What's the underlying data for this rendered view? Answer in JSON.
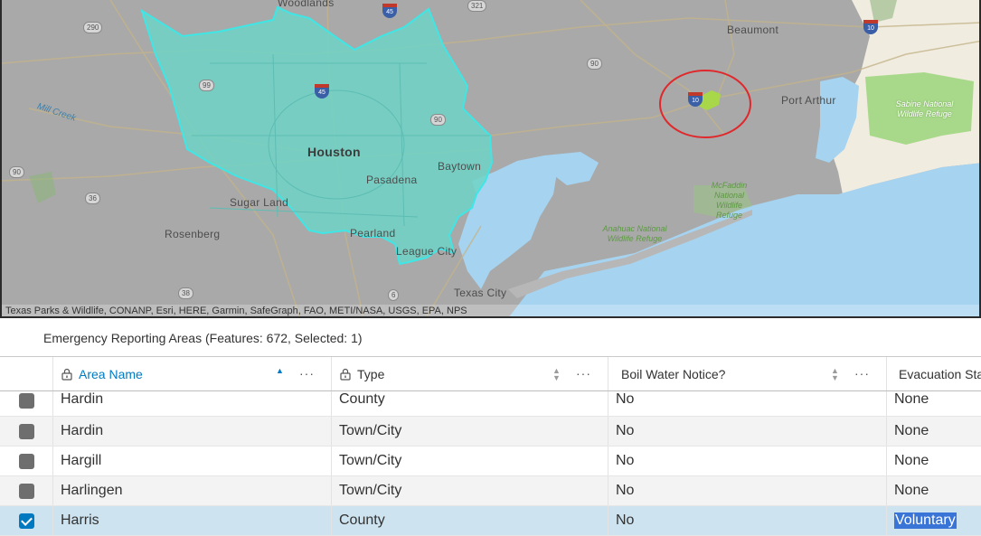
{
  "map": {
    "attribution": "Texas Parks & Wildlife, CONANP, Esri, HERE, Garmin, SafeGraph, FAO, METI/NASA, USGS, EPA, NPS",
    "labels": {
      "woodlands": "Woodlands",
      "beaumont": "Beaumont",
      "port_arthur": "Port Arthur",
      "houston": "Houston",
      "baytown": "Baytown",
      "pasadena": "Pasadena",
      "sugar_land": "Sugar Land",
      "rosenberg": "Rosenberg",
      "pearland": "Pearland",
      "league_city": "League City",
      "texas_city": "Texas City",
      "mill_creek": "Mill Creek",
      "sabine": "Sabine National Wildlife Refuge",
      "mcfaddin": "McFaddin National Wildlife Refuge",
      "anahuac": "Anahuac National Wildlife Refuge"
    },
    "shields": {
      "s290": "290",
      "s321": "321",
      "s90a": "90",
      "s99": "99",
      "s90b": "90",
      "s90c": "90",
      "s36": "36",
      "s38": "38",
      "s6": "6",
      "i45": "45",
      "i10a": "10",
      "i10b": "10",
      "i45b": "45"
    },
    "colors": {
      "basemap": "#a9a9a9",
      "water": "#a6d3f0",
      "highlight_fill": "#6fd3c7",
      "highlight_stroke": "#3fe6e6",
      "annotation_circle": "#e0282c",
      "selected_feature": "#a8d84a"
    }
  },
  "table": {
    "caption": "Emergency Reporting Areas (Features: 672, Selected: 1)",
    "columns": [
      {
        "label": "Area Name",
        "sorted": "ascending"
      },
      {
        "label": "Type"
      },
      {
        "label": "Boil Water Notice?"
      },
      {
        "label": "Evacuation Sta"
      }
    ],
    "rows": [
      {
        "name": "Hardin",
        "type": "County",
        "boil": "No",
        "evac": "None",
        "checked": false
      },
      {
        "name": "Hardin",
        "type": "Town/City",
        "boil": "No",
        "evac": "None",
        "checked": false
      },
      {
        "name": "Hargill",
        "type": "Town/City",
        "boil": "No",
        "evac": "None",
        "checked": false
      },
      {
        "name": "Harlingen",
        "type": "Town/City",
        "boil": "No",
        "evac": "None",
        "checked": false
      },
      {
        "name": "Harris",
        "type": "County",
        "boil": "No",
        "evac": "Voluntary",
        "checked": true
      }
    ],
    "more_label": "···"
  }
}
